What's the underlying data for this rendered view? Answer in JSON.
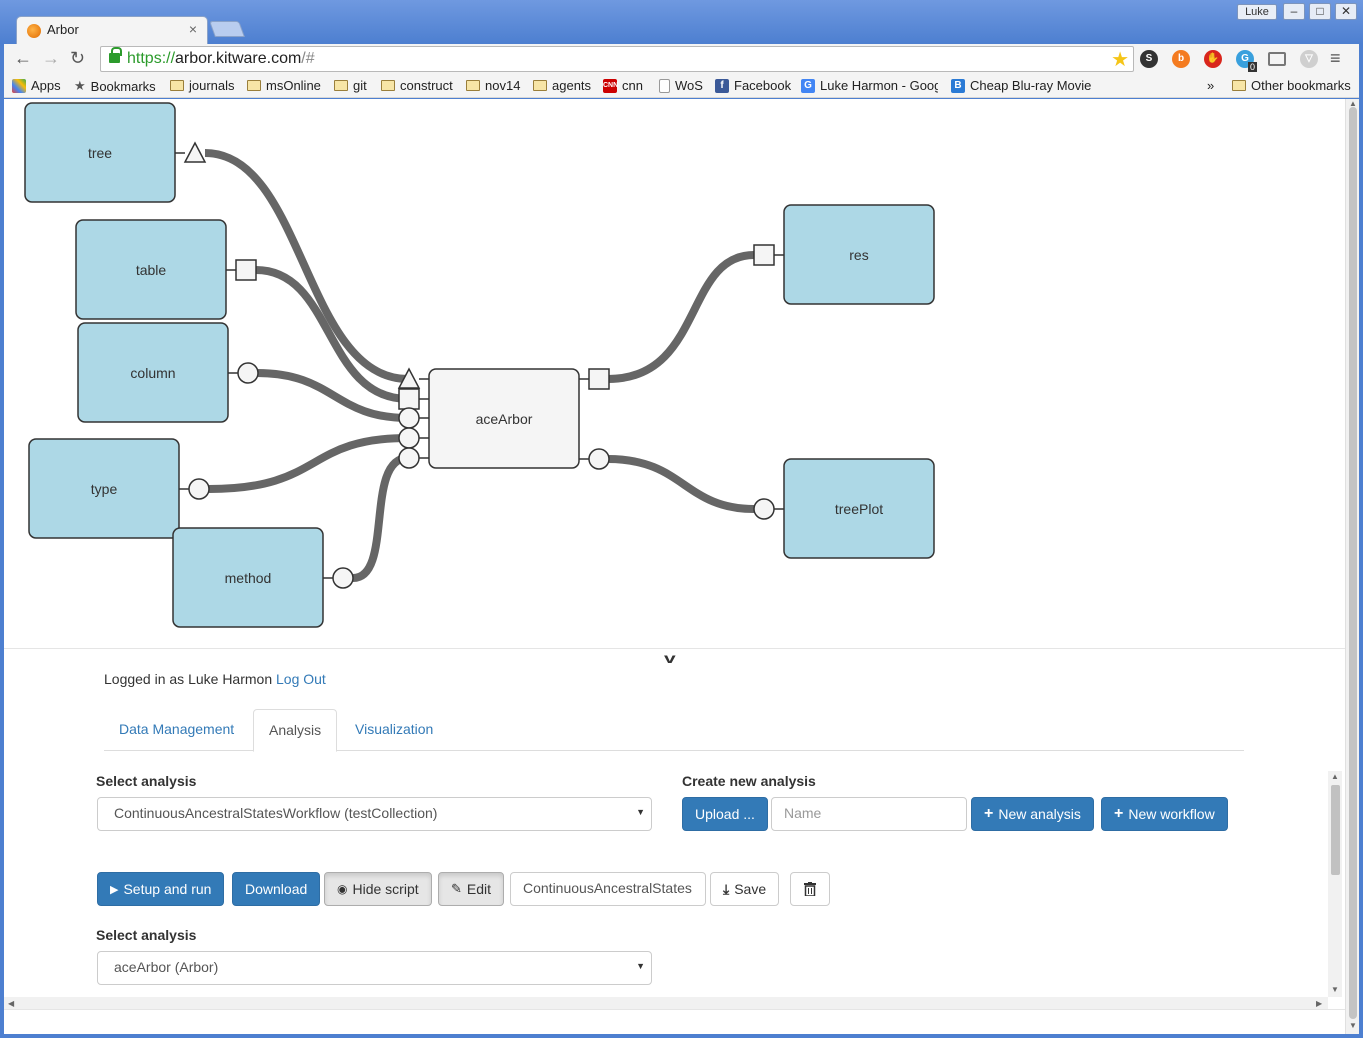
{
  "browser": {
    "tab_title": "Arbor",
    "tab_close": "×",
    "user": "Luke",
    "window_controls": {
      "minimize": "–",
      "maximize": "□",
      "close": "✕"
    },
    "nav": {
      "back": "←",
      "forward": "→",
      "reload": "↻"
    },
    "url": {
      "scheme": "https://",
      "host": "arbor.kitware.com",
      "path": "/#"
    },
    "extension_badge": "0",
    "bookmarks": [
      {
        "label": "Apps",
        "icon": "apps-grid-icon"
      },
      {
        "label": "Bookmarks",
        "icon": "star-icon"
      },
      {
        "label": "journals",
        "icon": "folder-icon"
      },
      {
        "label": "msOnline",
        "icon": "folder-icon"
      },
      {
        "label": "git",
        "icon": "folder-icon"
      },
      {
        "label": "construct",
        "icon": "folder-icon"
      },
      {
        "label": "nov14",
        "icon": "folder-icon"
      },
      {
        "label": "agents",
        "icon": "folder-icon"
      },
      {
        "label": "cnn",
        "icon": "cnn-icon"
      },
      {
        "label": "WoS",
        "icon": "page-icon"
      },
      {
        "label": "Facebook",
        "icon": "facebook-icon"
      },
      {
        "label": "Luke Harmon - Googl",
        "icon": "google-scholar-icon"
      },
      {
        "label": "Cheap Blu-ray Movie",
        "icon": "b-icon"
      }
    ],
    "bookmarks_overflow": "»",
    "other_bookmarks": "Other bookmarks"
  },
  "workflow": {
    "nodes": {
      "tree": "tree",
      "table": "table",
      "column": "column",
      "type": "type",
      "method": "method",
      "aceArbor": "aceArbor",
      "res": "res",
      "treePlot": "treePlot"
    },
    "colors": {
      "input_node": "#add8e6",
      "step_node": "#f5f5f5",
      "connection": "#666666"
    }
  },
  "panel": {
    "logged_in_text": "Logged in as Luke Harmon",
    "logout": "Log Out",
    "tabs": [
      {
        "label": "Data Management"
      },
      {
        "label": "Analysis"
      },
      {
        "label": "Visualization"
      }
    ],
    "select_analysis_label": "Select analysis",
    "selected_analysis": "ContinuousAncestralStatesWorkflow (testCollection)",
    "create_new_label": "Create new analysis",
    "upload": "Upload ...",
    "name_placeholder": "Name",
    "new_analysis": "New analysis",
    "new_workflow": "New workflow",
    "setup_and_run": "Setup and run",
    "download": "Download",
    "hide_script": "Hide script",
    "edit": "Edit",
    "analysis_name_value": "ContinuousAncestralStates",
    "save": "Save",
    "select_analysis_label_2": "Select analysis",
    "selected_step": "aceArbor (Arbor)",
    "caret": "▼"
  },
  "colors": {
    "primary": "#337ab7",
    "link": "#337ab7"
  }
}
